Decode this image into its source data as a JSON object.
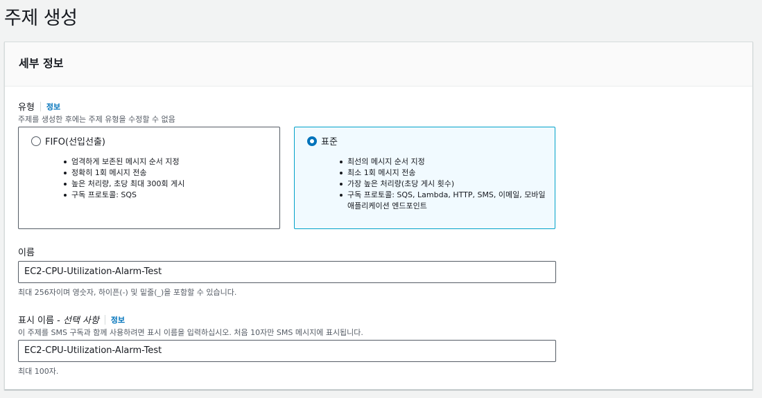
{
  "page": {
    "title": "주제 생성"
  },
  "panel": {
    "heading": "세부 정보"
  },
  "type": {
    "label": "유형",
    "info": "정보",
    "description": "주제를 생성한 후에는 주제 유형을 수정할 수 없음",
    "options": [
      {
        "title": "FIFO(선입선출)",
        "selected": false,
        "bullets": [
          "엄격하게 보존된 메시지 순서 지정",
          "정확히 1회 메시지 전송",
          "높은 처리량, 초당 최대 300회 게시",
          "구독 프로토콜: SQS"
        ]
      },
      {
        "title": "표준",
        "selected": true,
        "bullets": [
          "최선의 메시지 순서 지정",
          "최소 1회 메시지 전송",
          "가장 높은 처리량(초당 게시 횟수)",
          "구독 프로토콜: SQS, Lambda, HTTP, SMS, 이메일, 모바일 애플리케이션 엔드포인트"
        ]
      }
    ]
  },
  "name": {
    "label": "이름",
    "value": "EC2-CPU-Utilization-Alarm-Test",
    "constraint": "최대 256자이며 영숫자, 하이픈(-) 및 밑줄(_)을 포함할 수 있습니다."
  },
  "display_name": {
    "label": "표시 이름 - ",
    "optional": "선택 사항",
    "info": "정보",
    "description": "이 주제를 SMS 구독과 함께 사용하려면 표시 이름을 입력하십시오. 처음 10자만 SMS 메시지에 표시됩니다.",
    "value": "EC2-CPU-Utilization-Alarm-Test",
    "constraint": "최대 100자."
  },
  "colors": {
    "accent": "#0073bb",
    "selected_border": "#00a1c9",
    "selected_bg": "#f1faff"
  }
}
